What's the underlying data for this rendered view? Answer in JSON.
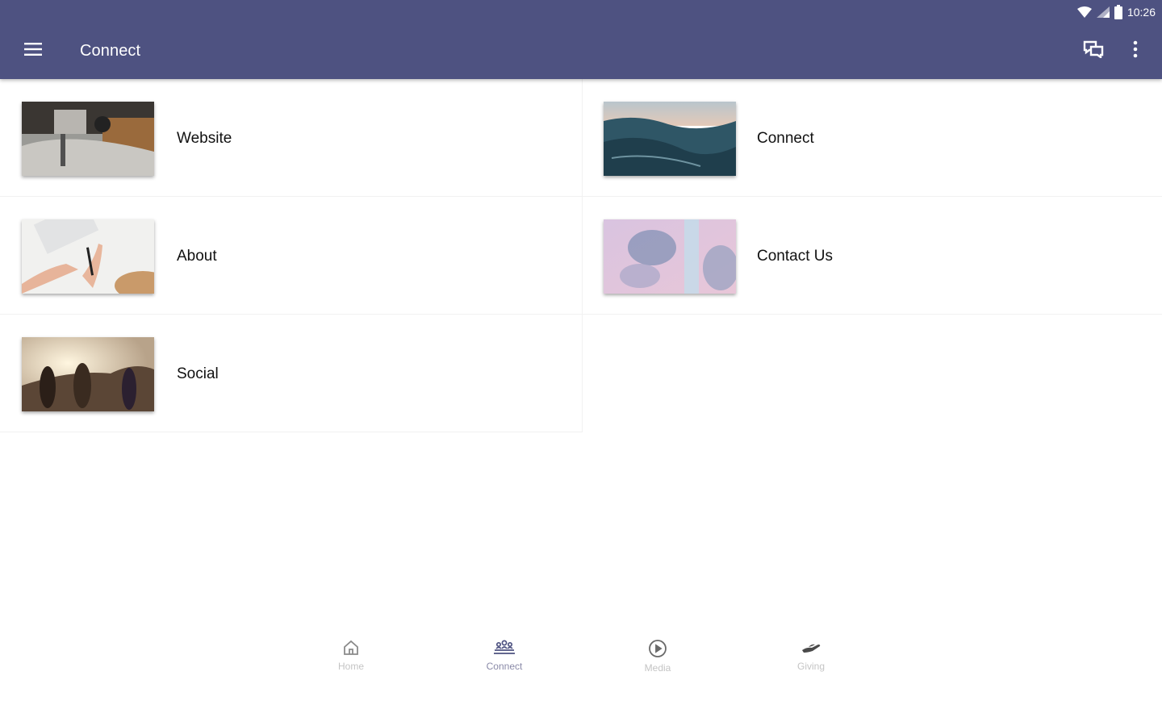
{
  "status_bar": {
    "time": "10:26",
    "icons": [
      "wifi-icon",
      "signal-icon",
      "battery-icon"
    ]
  },
  "app_bar": {
    "title": "Connect",
    "icons": [
      "menu-icon",
      "chat-icon",
      "more-vertical-icon"
    ]
  },
  "items": [
    {
      "label": "Website",
      "image": "desk-keyboard-photo"
    },
    {
      "label": "Connect",
      "image": "ocean-waves-photo"
    },
    {
      "label": "About",
      "image": "writing-hands-photo"
    },
    {
      "label": "Contact Us",
      "image": "pink-clouds-photo"
    },
    {
      "label": "Social",
      "image": "friends-sunset-photo"
    }
  ],
  "bottom_nav": {
    "active": "Connect",
    "items": [
      {
        "label": "Home",
        "icon": "home-icon"
      },
      {
        "label": "Connect",
        "icon": "people-group-icon"
      },
      {
        "label": "Media",
        "icon": "play-circle-icon"
      },
      {
        "label": "Giving",
        "icon": "giving-hand-icon"
      }
    ]
  },
  "colors": {
    "app_bar": "#4e5281",
    "nav_active": "#4e5281",
    "nav_inactive": "#c4c4c4"
  }
}
